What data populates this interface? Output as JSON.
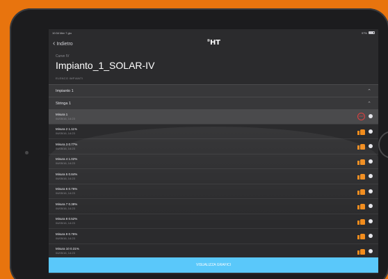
{
  "statusbar": {
    "left": "10:34  Mer 7 giu",
    "right": "97%"
  },
  "nav": {
    "back_label": "Indietro",
    "logo_mark": "HT",
    "logo_sup": "®"
  },
  "header": {
    "subtitle": "Curve IV",
    "title": "Impianto_1_SOLAR-IV",
    "section": "ELENCO IMPIANTI"
  },
  "groups": [
    {
      "label": "Impianto 1"
    },
    {
      "label": "Stringa 1"
    }
  ],
  "rows": [
    {
      "name": "Misura 1",
      "date": "04/05/16, 14:23",
      "status": "warning",
      "warning_text": "LIMIT"
    },
    {
      "name": "Misura 2 1.11%",
      "date": "04/05/16, 14:23",
      "status": "ok"
    },
    {
      "name": "Misura 3 0.77%",
      "date": "04/05/16, 14:23",
      "status": "ok"
    },
    {
      "name": "Misura 4 1.02%",
      "date": "04/05/16, 14:23",
      "status": "ok"
    },
    {
      "name": "Misura 5 0.84%",
      "date": "04/05/16, 14:23",
      "status": "ok"
    },
    {
      "name": "Misura 6 0.76%",
      "date": "04/05/16, 14:23",
      "status": "ok"
    },
    {
      "name": "Misura 7 0.38%",
      "date": "04/05/16, 14:23",
      "status": "ok"
    },
    {
      "name": "Misura 8 0.52%",
      "date": "04/05/16, 14:23",
      "status": "ok"
    },
    {
      "name": "Misura 9 0.76%",
      "date": "04/05/16, 14:23",
      "status": "ok"
    },
    {
      "name": "Misura 10 0.31%",
      "date": "04/05/16, 14:23",
      "status": "ok"
    }
  ],
  "bottom_button": "VISUALIZZA GRAFICI",
  "colors": {
    "accent": "#5ac8fa",
    "ok_icon": "#f28c1c",
    "warning": "#e04040",
    "background": "#e8740e"
  }
}
